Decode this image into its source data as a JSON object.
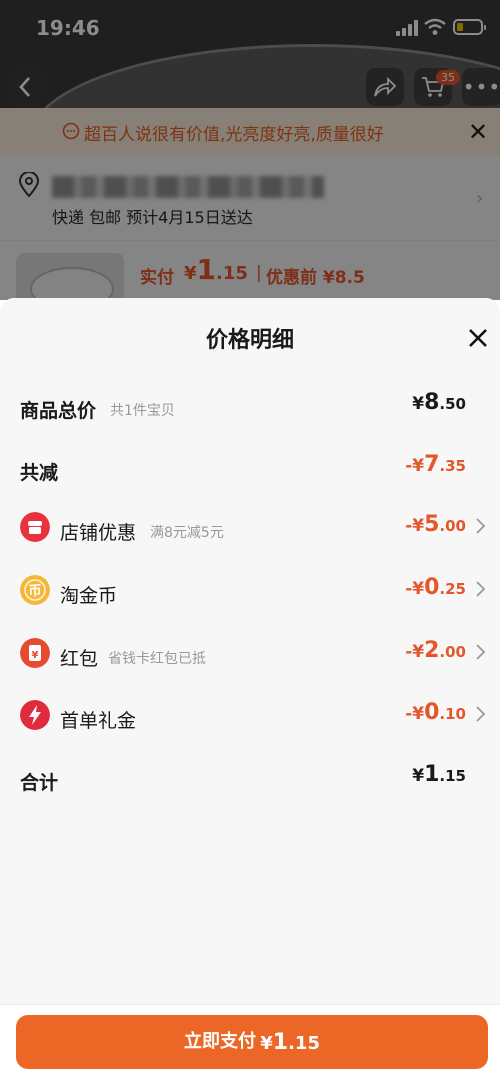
{
  "status_bar": {
    "time": "19:46"
  },
  "header": {
    "cart_count": "35"
  },
  "notice": {
    "text": "超百人说很有价值,光亮度好亮,质量很好"
  },
  "address": {
    "delivery": "快递 包邮 预计4月15日送达"
  },
  "product": {
    "pay_label": "实付",
    "pay_symbol": "¥",
    "pay_int": "1",
    "pay_dec": ".15",
    "separator": "|",
    "original_price": "优惠前 ¥8.5"
  },
  "sheet": {
    "title": "价格明细",
    "rows": [
      {
        "label": "商品总价",
        "hint": "共1件宝贝",
        "symbol": "¥",
        "int": "8",
        "dec": ".50"
      },
      {
        "label": "共减",
        "hint": "",
        "symbol": "-¥",
        "int": "7",
        "dec": ".35"
      },
      {
        "label": "店铺优惠",
        "hint": "满8元减5元",
        "symbol": "-¥",
        "int": "5",
        "dec": ".00"
      },
      {
        "label": "淘金币",
        "hint": "",
        "symbol": "-¥",
        "int": "0",
        "dec": ".25"
      },
      {
        "label": "红包",
        "hint": "省钱卡红包已抵",
        "symbol": "-¥",
        "int": "2",
        "dec": ".00"
      },
      {
        "label": "首单礼金",
        "hint": "",
        "symbol": "-¥",
        "int": "0",
        "dec": ".10"
      },
      {
        "label": "合计",
        "hint": "",
        "symbol": "¥",
        "int": "1",
        "dec": ".15"
      }
    ],
    "icons": {
      "shop": "店",
      "coin": "币",
      "redpack": "¥"
    }
  },
  "pay_button": {
    "label": "立即支付",
    "symbol": "¥",
    "int": "1",
    "dec": ".15"
  },
  "colors": {
    "accent": "#ec6626",
    "discount": "#e4572b"
  }
}
